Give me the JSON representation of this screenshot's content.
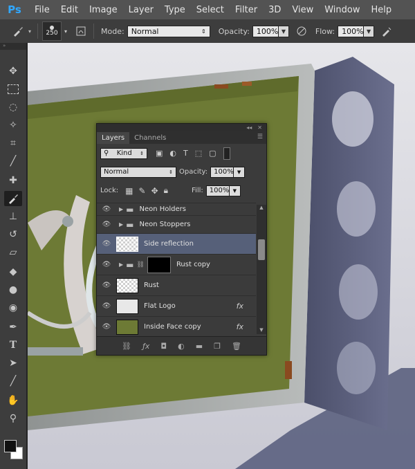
{
  "menubar": {
    "logo": "Ps",
    "items": [
      "File",
      "Edit",
      "Image",
      "Layer",
      "Type",
      "Select",
      "Filter",
      "3D",
      "View",
      "Window",
      "Help"
    ]
  },
  "options": {
    "brush_size": "250",
    "mode_label": "Mode:",
    "mode_value": "Normal",
    "opacity_label": "Opacity:",
    "opacity_value": "100%",
    "flow_label": "Flow:",
    "flow_value": "100%"
  },
  "layers_panel": {
    "tabs": [
      "Layers",
      "Channels"
    ],
    "filter_kind": "Kind",
    "blend_mode": "Normal",
    "opacity_label": "Opacity:",
    "opacity_value": "100%",
    "lock_label": "Lock:",
    "fill_label": "Fill:",
    "fill_value": "100%",
    "layers": [
      {
        "name": "Neon Holders",
        "type": "group"
      },
      {
        "name": "Neon Stoppers",
        "type": "group"
      },
      {
        "name": "Side reflection",
        "type": "layer",
        "selected": true
      },
      {
        "name": "Rust copy",
        "type": "group-masked"
      },
      {
        "name": "Rust",
        "type": "layer"
      },
      {
        "name": "Flat Logo",
        "type": "smart",
        "fx": "fx"
      },
      {
        "name": "Inside Face copy",
        "type": "smart",
        "fx": "fx"
      }
    ]
  },
  "colors": {
    "accent": "#31a8ff",
    "selected_layer": "#566079"
  }
}
